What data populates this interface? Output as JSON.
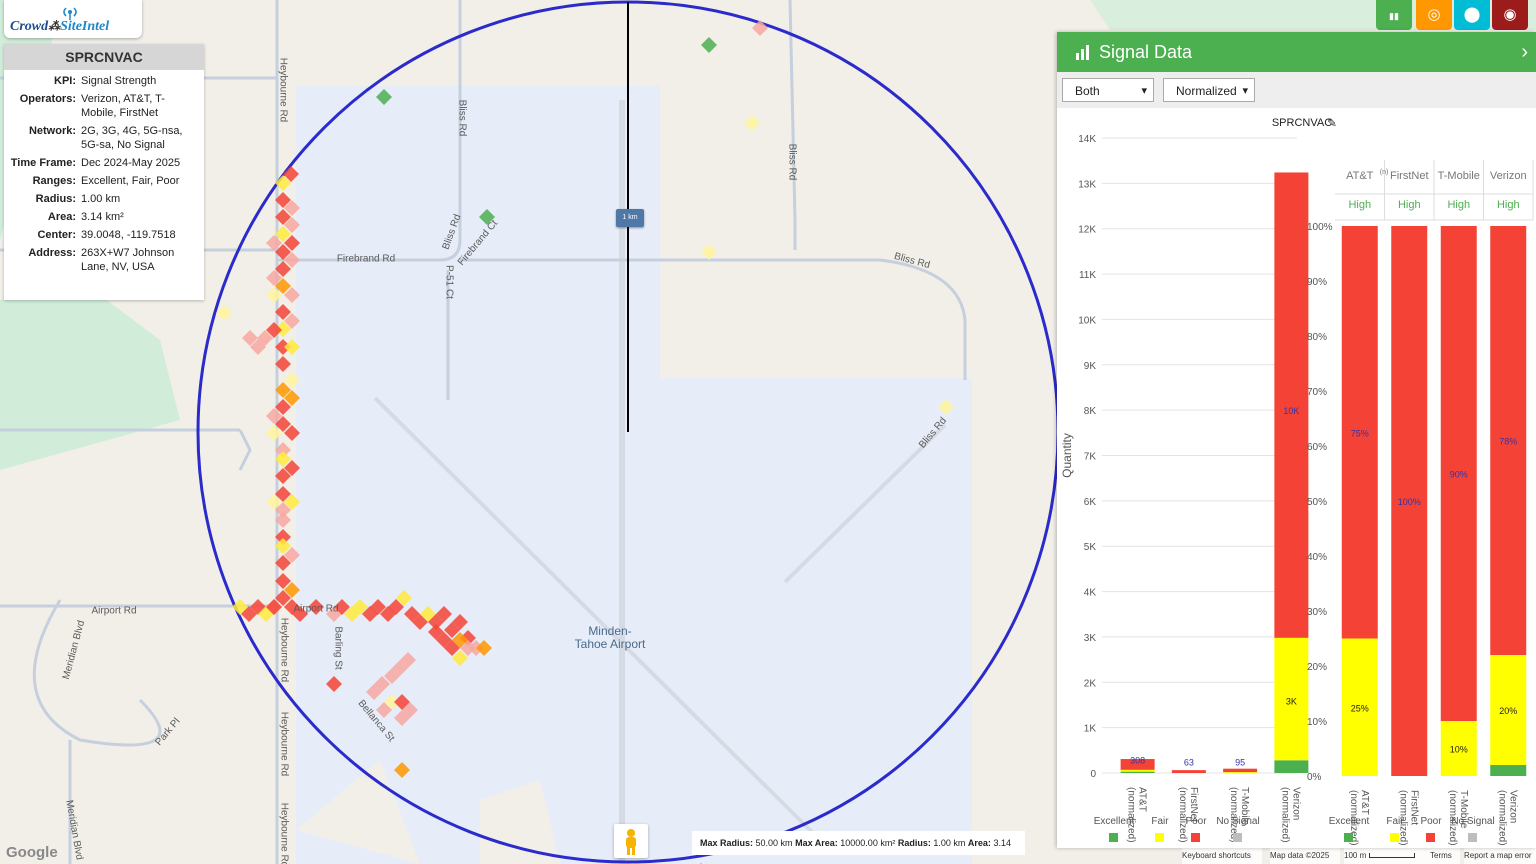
{
  "app": {
    "logo_crowd": "Crowd",
    "logo_site": "SiteIntel",
    "top_buttons": [
      {
        "name": "chart-icon",
        "color": "#4caf50"
      },
      {
        "name": "target-icon",
        "color": "#ff9800"
      },
      {
        "name": "location-pin-icon",
        "color": "#00bcd4"
      },
      {
        "name": "globe-icon",
        "color": "#9c1c1c"
      }
    ]
  },
  "info_panel": {
    "title": "SPRCNVAC",
    "rows": [
      {
        "key": "KPI:",
        "value": "Signal Strength"
      },
      {
        "key": "Operators:",
        "value": "Verizon, AT&T, T-Mobile, FirstNet"
      },
      {
        "key": "Network:",
        "value": "2G, 3G, 4G, 5G-nsa, 5G-sa, No Signal"
      },
      {
        "key": "Time Frame:",
        "value": "Dec 2024-May 2025"
      },
      {
        "key": "Ranges:",
        "value": "Excellent, Fair, Poor"
      },
      {
        "key": "Radius:",
        "value": "1.00 km"
      },
      {
        "key": "Area:",
        "value": "3.14 km²"
      },
      {
        "key": "Center:",
        "value": "39.0048, -119.7518"
      },
      {
        "key": "Address:",
        "value": "263X+W7 Johnson Lane, NV, USA"
      }
    ]
  },
  "map": {
    "labels": [
      {
        "text": "Heybourne Rd",
        "rot": 90
      },
      {
        "text": "Bliss Rd",
        "rot": 90
      },
      {
        "text": "Bliss Rd",
        "rot": 90
      },
      {
        "text": "Firebrand Rd",
        "rot": 0
      },
      {
        "text": "Bliss Rd",
        "rot": -70
      },
      {
        "text": "Firebrand Ct",
        "rot": -50
      },
      {
        "text": "P-51 Ct",
        "rot": 90
      },
      {
        "text": "Bliss Rd",
        "rot": 15
      },
      {
        "text": "Bliss Rd",
        "rot": -50
      },
      {
        "text": "Airport Rd",
        "rot": 0
      },
      {
        "text": "Airport Rd",
        "rot": 0
      },
      {
        "text": "Heybourne Rd",
        "rot": 90
      },
      {
        "text": "Heybourne Rd",
        "rot": 90
      },
      {
        "text": "Heybourne Rd",
        "rot": 90
      },
      {
        "text": "Barling St",
        "rot": 90
      },
      {
        "text": "Bellanca St",
        "rot": 50
      },
      {
        "text": "Meridian Blvd",
        "rot": -75
      },
      {
        "text": "Park Pl",
        "rot": -50
      },
      {
        "text": "Meridian Blvd",
        "rot": 80
      }
    ],
    "airport_label": "Minden-\nTahoe Airport",
    "radius_label": "1 km",
    "scale_text": {
      "max_radius_label": "Max Radius:",
      "max_radius_value": "50.00 km",
      "max_area_label": "Max Area:",
      "max_area_value": "10000.00 km²",
      "radius_label": "Radius:",
      "radius_value": "1.00 km",
      "area_label": "Area:",
      "area_value": "3.14 km²"
    },
    "attribution": {
      "shortcuts": "Keyboard shortcuts",
      "map_data": "Map data ©2025",
      "scale": "100 m",
      "terms": "Terms",
      "report": "Report a map error",
      "google": "Google"
    },
    "circle_color": "#2b2bcc"
  },
  "signal_panel": {
    "title": "Signal Data",
    "select_mode": "Both",
    "select_view": "Normalized",
    "chart_title": "SPRCNVAC",
    "legend": [
      {
        "label": "Excellent",
        "color": "#4caf50"
      },
      {
        "label": "Fair",
        "color": "#ffff00"
      },
      {
        "label": "Poor",
        "color": "#f44336"
      },
      {
        "label": "No Signal",
        "color": "#bdbdbd"
      }
    ],
    "header_ops": [
      "AT&T",
      "FirstNet",
      "T-Mobile",
      "Verizon"
    ],
    "header_superscript": "(n)",
    "header_level": [
      "High",
      "High",
      "High",
      "High"
    ]
  },
  "chart_data": [
    {
      "type": "bar",
      "stacked": true,
      "ylabel": "Quantity",
      "ylim": [
        0,
        14000
      ],
      "yticks": [
        "0",
        "1K",
        "2K",
        "3K",
        "4K",
        "5K",
        "6K",
        "7K",
        "8K",
        "9K",
        "10K",
        "11K",
        "12K",
        "13K",
        "14K"
      ],
      "categories": [
        "AT&T (normalized)",
        "FirstNet (normalized)",
        "T-Mobile (normalized)",
        "Verizon (normalized)"
      ],
      "series": [
        {
          "name": "Excellent",
          "values": [
            30,
            0,
            0,
            280
          ]
        },
        {
          "name": "Fair",
          "values": [
            40,
            0,
            20,
            2700
          ]
        },
        {
          "name": "Poor",
          "values": [
            238,
            63,
            75,
            10260
          ]
        }
      ],
      "labels": [
        {
          "cat": 0,
          "text": "308"
        },
        {
          "cat": 1,
          "text": "63"
        },
        {
          "cat": 2,
          "text": "95"
        },
        {
          "cat": 3,
          "text": "3K"
        },
        {
          "cat": 3,
          "text": "10K"
        }
      ]
    },
    {
      "type": "bar",
      "stacked": true,
      "ylim": [
        0,
        100
      ],
      "yticks": [
        "0%",
        "10%",
        "20%",
        "30%",
        "40%",
        "50%",
        "60%",
        "70%",
        "80%",
        "90%",
        "100%"
      ],
      "categories": [
        "AT&T (normalized)",
        "FirstNet (normalized)",
        "T-Mobile (normalized)",
        "Verizon (normalized)"
      ],
      "series": [
        {
          "name": "Excellent",
          "values": [
            0,
            0,
            0,
            2
          ]
        },
        {
          "name": "Fair",
          "values": [
            25,
            0,
            10,
            20
          ]
        },
        {
          "name": "Poor",
          "values": [
            75,
            100,
            90,
            78
          ]
        }
      ],
      "labels": [
        {
          "cat": 0,
          "text": "25%"
        },
        {
          "cat": 0,
          "text": "75%"
        },
        {
          "cat": 1,
          "text": "100%"
        },
        {
          "cat": 2,
          "text": "10%"
        },
        {
          "cat": 2,
          "text": "90%"
        },
        {
          "cat": 3,
          "text": "20%"
        },
        {
          "cat": 3,
          "text": "78%"
        }
      ]
    }
  ]
}
